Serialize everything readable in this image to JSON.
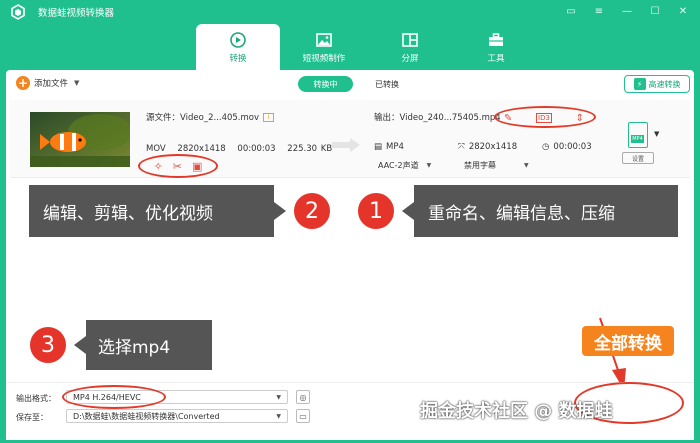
{
  "window": {
    "title": "数据蛙视频转换器",
    "controls": [
      "chat-icon",
      "menu-icon",
      "minimize-icon",
      "maximize-icon",
      "close-icon"
    ]
  },
  "nav_tabs": [
    {
      "label": "转换",
      "icon": "convert-icon",
      "active": true
    },
    {
      "label": "短视频制作",
      "icon": "image-icon",
      "active": false
    },
    {
      "label": "分屏",
      "icon": "split-screen-icon",
      "active": false
    },
    {
      "label": "工具",
      "icon": "toolbox-icon",
      "active": false
    }
  ],
  "toolbar": {
    "add_file_label": "添加文件",
    "tab_converting": "转换中",
    "tab_converted": "已转换",
    "fast_convert_label": "高速转换"
  },
  "file_item": {
    "source_label": "源文件：Video_2...405.mov",
    "source_format": "MOV",
    "source_resolution": "2820x1418",
    "source_duration": "00:00:03",
    "source_size": "225.30 KB",
    "output_label": "输出：Video_240...75405.mp4",
    "output_format": "MP4",
    "output_resolution": "2820x1418",
    "output_duration": "00:00:03",
    "audio_select": "AAC-2声道",
    "subtitle_select": "禁用字幕",
    "format_thumb_label": "MP4",
    "settings_label": "设置"
  },
  "callouts": {
    "c1_text": "重命名、编辑信息、压缩",
    "c1_number": "1",
    "c2_text": "编辑、剪辑、优化视频",
    "c2_number": "2",
    "c3_text": "选择mp4",
    "c3_number": "3"
  },
  "bottom": {
    "output_format_label": "输出格式：",
    "output_format_value": "MP4 H.264/HEVC",
    "save_to_label": "保存至：",
    "save_to_value": "D:\\数据蛙\\数据蛙视频转换器\\Converted",
    "convert_button": "全部转换"
  },
  "watermark": "掘金技术社区 @ 数据蛙",
  "colors": {
    "brand": "#1fbf8e",
    "accent": "#f5841f",
    "annotation": "#e23a2a"
  }
}
